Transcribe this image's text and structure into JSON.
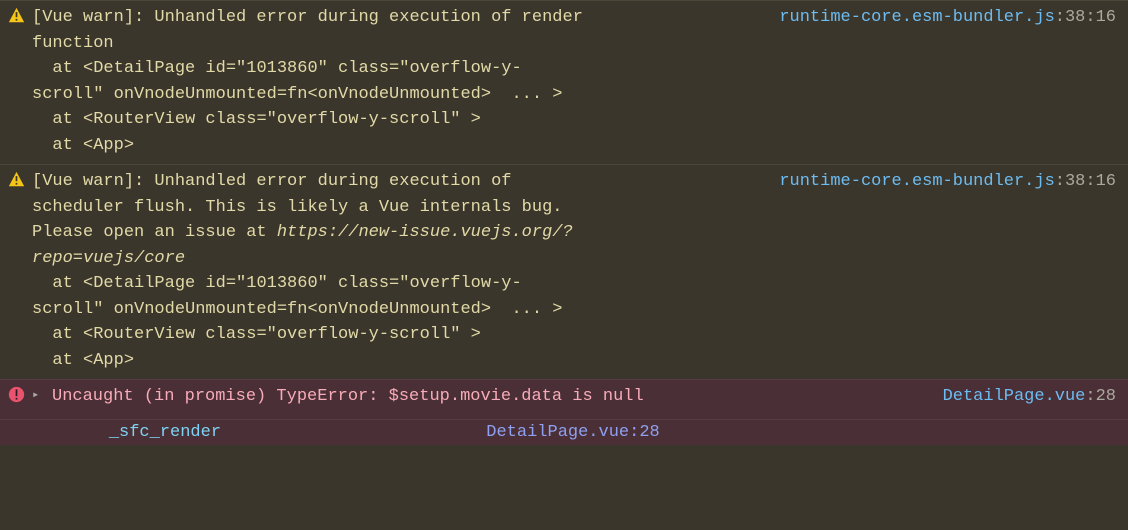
{
  "entries": [
    {
      "type": "warn",
      "message": "[Vue warn]: Unhandled error during execution of render function \n  at <DetailPage id=\"1013860\" class=\"overflow-y-scroll\" onVnodeUnmounted=fn<onVnodeUnmounted>  ... > \n  at <RouterView class=\"overflow-y-scroll\" > \n  at <App>",
      "source_file": "runtime-core.esm-bundler.js",
      "source_line": 38,
      "source_col": 16
    },
    {
      "type": "warn",
      "message_prefix": "[Vue warn]: Unhandled error during execution of scheduler flush. This is likely a Vue internals bug. Please open an issue at ",
      "message_italic": "https://new-issue.vuejs.org/?repo=vuejs/core",
      "message_suffix": " \n  at <DetailPage id=\"1013860\" class=\"overflow-y-scroll\" onVnodeUnmounted=fn<onVnodeUnmounted>  ... > \n  at <RouterView class=\"overflow-y-scroll\" > \n  at <App>",
      "source_file": "runtime-core.esm-bundler.js",
      "source_line": 38,
      "source_col": 16
    },
    {
      "type": "error",
      "expandable": true,
      "message": "Uncaught (in promise) TypeError: $setup.movie.data is null",
      "source_file": "DetailPage.vue",
      "source_line": 28,
      "stack": {
        "fn": "_sfc_render",
        "file": "DetailPage.vue",
        "line": 28
      }
    }
  ],
  "icons": {
    "warn": "warning-icon",
    "error": "error-icon",
    "expand": "▸"
  }
}
